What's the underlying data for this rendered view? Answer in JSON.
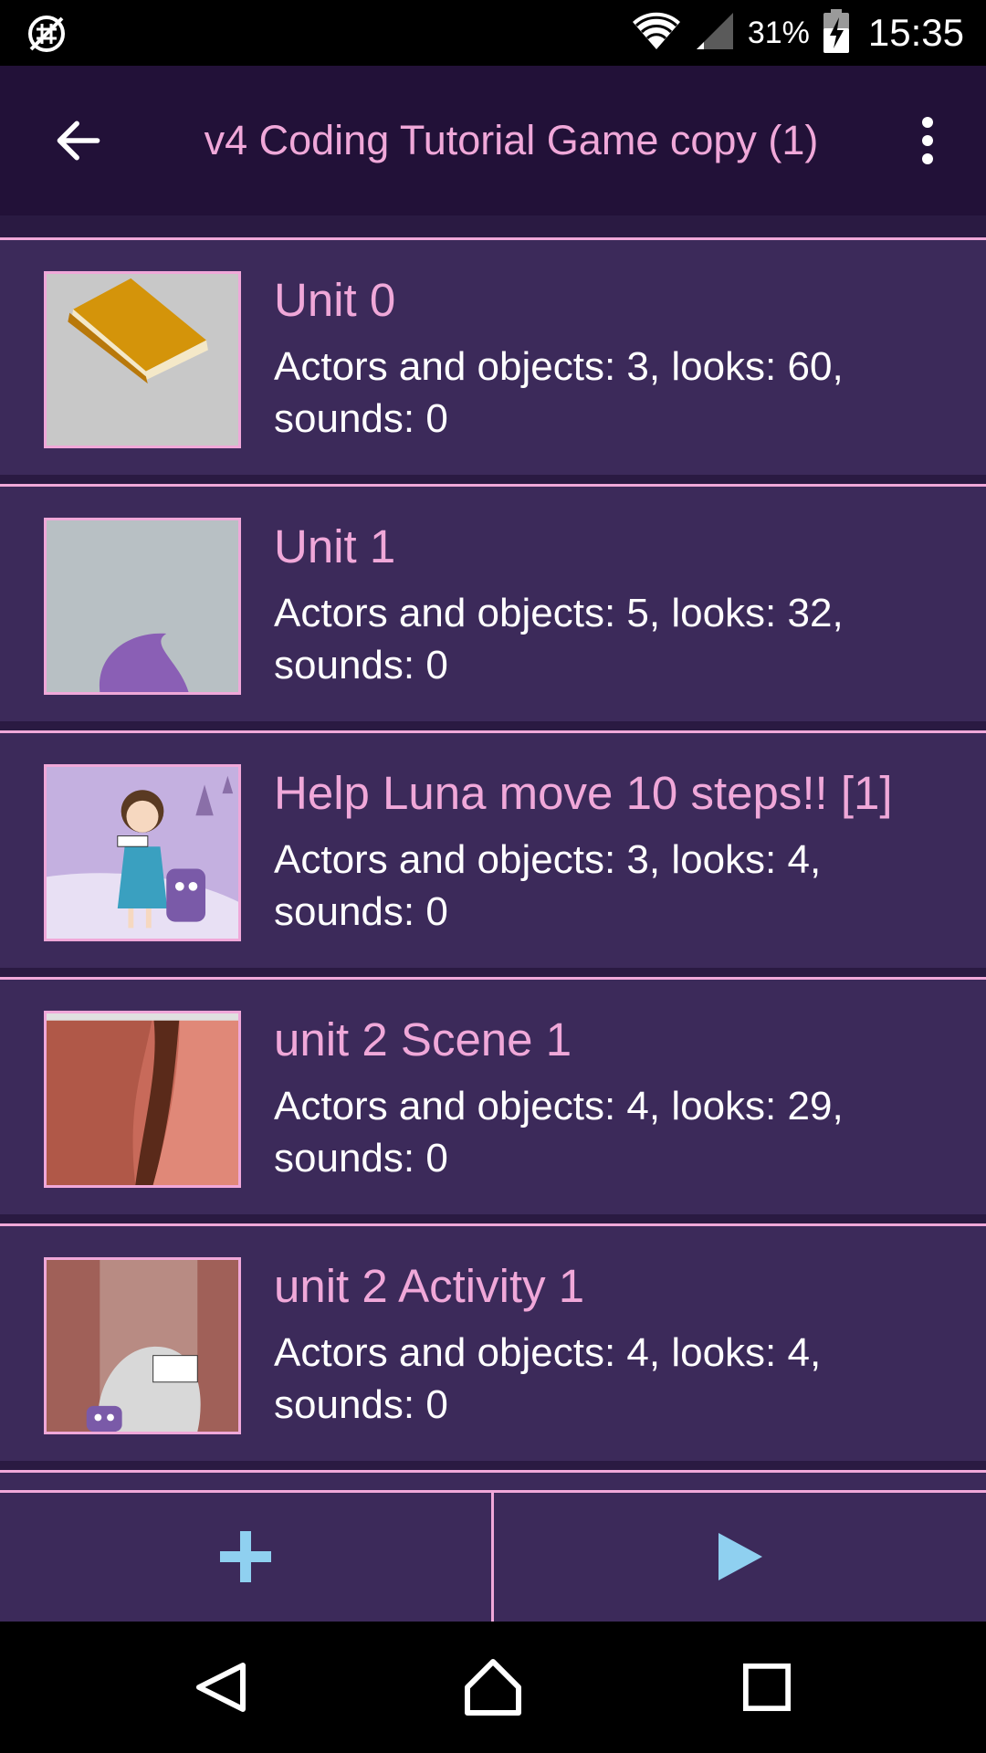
{
  "status_bar": {
    "battery_text": "31%",
    "time": "15:35",
    "icons": [
      "no-sync-icon",
      "wifi-icon",
      "signal-icon",
      "battery-charging-icon"
    ]
  },
  "app_bar": {
    "title": "v4 Coding Tutorial Game copy (1)",
    "back_icon": "arrow-left-icon",
    "menu_icon": "more-vertical-icon"
  },
  "scenes": [
    {
      "title": "Unit 0",
      "details": "Actors and objects: 3, looks: 60, sounds: 0"
    },
    {
      "title": "Unit 1",
      "details": "Actors and objects: 5, looks: 32, sounds: 0"
    },
    {
      "title": "Help Luna move 10 steps!! [1]",
      "details": "Actors and objects: 3, looks: 4, sounds: 0"
    },
    {
      "title": "unit 2 Scene 1",
      "details": "Actors and objects: 4, looks: 29, sounds: 0"
    },
    {
      "title": "unit 2 Activity 1",
      "details": "Actors and objects: 4, looks: 4, sounds: 0"
    }
  ],
  "bottom_bar": {
    "add_icon": "plus-icon",
    "play_icon": "play-icon"
  },
  "nav_bar": {
    "icons": [
      "back-triangle-icon",
      "home-icon",
      "recents-icon"
    ]
  },
  "colors": {
    "accent_pink": "#f0a8d9",
    "app_bar_bg": "#221138",
    "row_bg": "#3c2a5a",
    "icon_blue": "#8fd0f0"
  }
}
